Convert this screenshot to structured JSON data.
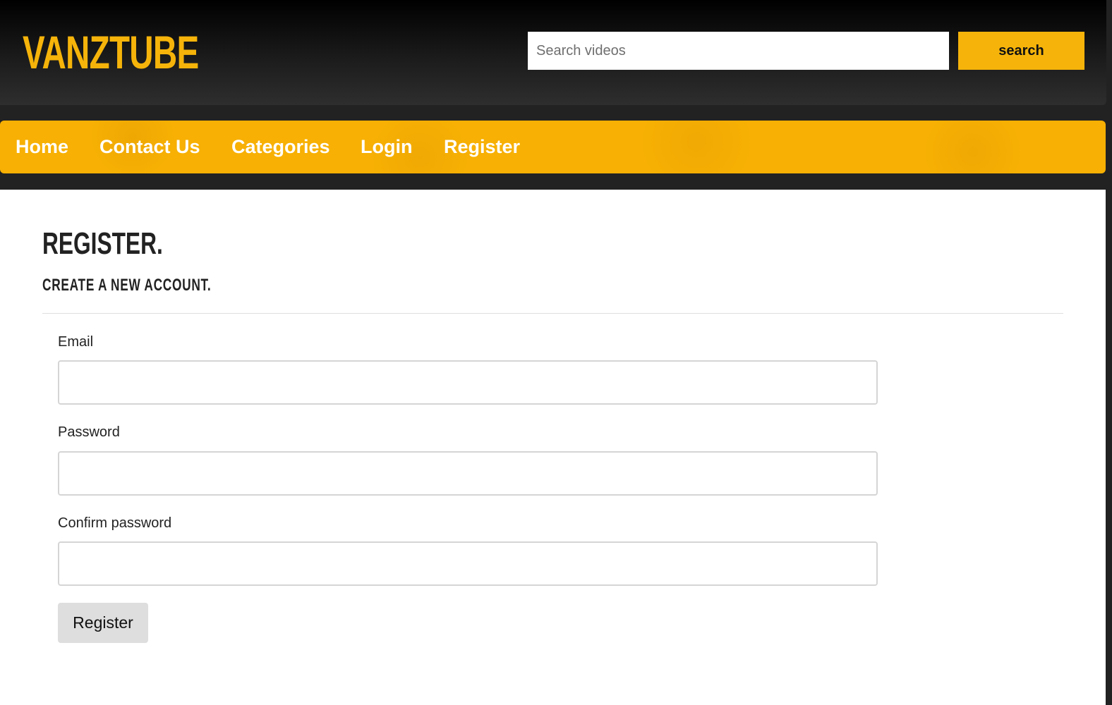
{
  "brand": {
    "logo_text": "VANZTUBE",
    "accent_color": "#f6b40a"
  },
  "search": {
    "placeholder": "Search videos",
    "value": "",
    "button_label": "search"
  },
  "nav": {
    "items": [
      {
        "label": "Home"
      },
      {
        "label": "Contact Us"
      },
      {
        "label": "Categories"
      },
      {
        "label": "Login"
      },
      {
        "label": "Register"
      }
    ]
  },
  "page": {
    "title": "REGISTER.",
    "subtitle": "CREATE A NEW ACCOUNT."
  },
  "form": {
    "fields": [
      {
        "label": "Email",
        "value": ""
      },
      {
        "label": "Password",
        "value": ""
      },
      {
        "label": "Confirm password",
        "value": ""
      }
    ],
    "submit_label": "Register"
  }
}
